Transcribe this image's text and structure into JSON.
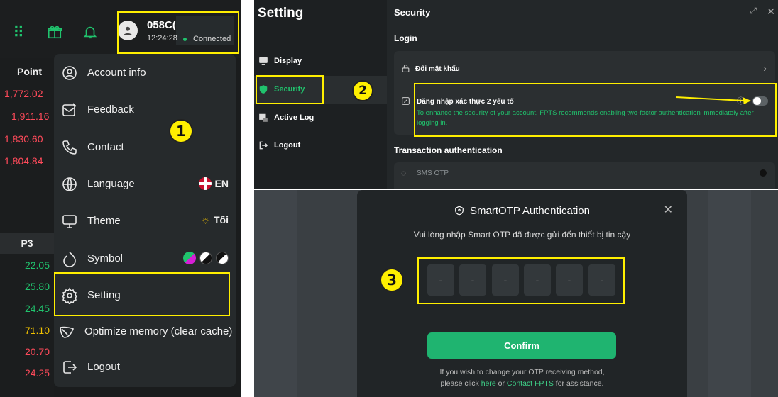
{
  "panel1": {
    "account": "058C(",
    "time": "12:24:28",
    "status": "Connected",
    "point_header": "Point",
    "point_values": [
      "1,772.02",
      "1,911.16",
      "1,830.60",
      "1,804.84"
    ],
    "p3_header": "P3",
    "p3_values": [
      {
        "v": "22.05",
        "color": "#20c36d"
      },
      {
        "v": "25.80",
        "color": "#20c36d"
      },
      {
        "v": "24.45",
        "color": "#20c36d"
      },
      {
        "v": "71.10",
        "color": "#f2c200"
      },
      {
        "v": "20.70",
        "color": "#ff4a5a"
      },
      {
        "v": "24.25",
        "color": "#ff4a5a"
      }
    ],
    "menu": [
      {
        "label": "Account info",
        "icon": "account-circle-icon"
      },
      {
        "label": "Feedback",
        "icon": "feedback-icon"
      },
      {
        "label": "Contact",
        "icon": "phone-icon"
      },
      {
        "label": "Language",
        "icon": "globe-icon",
        "right": "EN"
      },
      {
        "label": "Theme",
        "icon": "monitor-icon",
        "right": "Tối"
      },
      {
        "label": "Symbol",
        "icon": "symbol-icon"
      },
      {
        "label": "Setting",
        "icon": "gear-icon"
      },
      {
        "label": "Optimize memory (clear cache)",
        "icon": "leaf-icon"
      },
      {
        "label": "Logout",
        "icon": "logout-icon"
      }
    ],
    "step": "1",
    "accent": "#20c36d"
  },
  "panel2": {
    "sidebar_title": "Setting",
    "sidebar": [
      {
        "label": "Display",
        "icon": "monitor-icon"
      },
      {
        "label": "Security",
        "icon": "shield-icon"
      },
      {
        "label": "Active Log",
        "icon": "log-icon"
      },
      {
        "label": "Logout",
        "icon": "logout-icon"
      }
    ],
    "title": "Security",
    "login_heading": "Login",
    "change_password": "Đổi mật khẩu",
    "two_factor": "Đăng nhập xác thực 2 yếu tố",
    "two_factor_desc": "To enhance the security of your account, FPTS recommends enabling two-factor authentication immediately after logging in.",
    "transaction_heading": "Transaction authentication",
    "sms_otp": "SMS OTP",
    "step": "2"
  },
  "panel3": {
    "title": "SmartOTP Authentication",
    "subtitle": "Vui lòng nhập Smart OTP đã được gửi đến thiết bị tin cậy",
    "otp_digits": [
      "-",
      "-",
      "-",
      "-",
      "-",
      "-"
    ],
    "confirm": "Confirm",
    "footer_1": "If you wish to change your OTP receiving method,",
    "footer_2a": "please click",
    "footer_link1": "here",
    "footer_2b": "or",
    "footer_link2": "Contact FPTS",
    "footer_2c": "for assistance.",
    "step": "3"
  }
}
